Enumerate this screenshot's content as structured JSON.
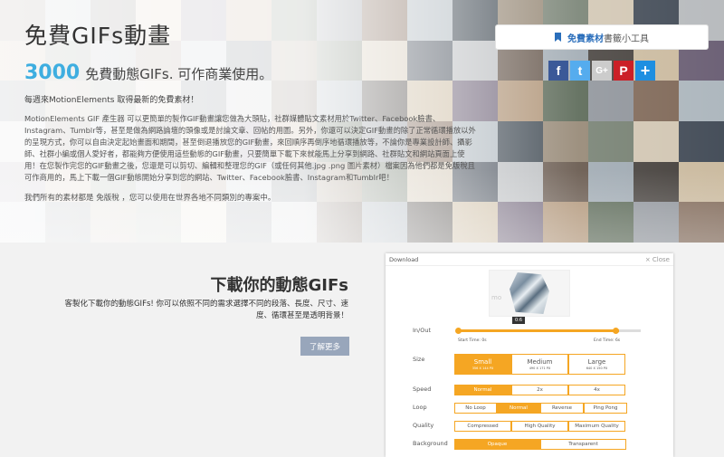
{
  "hero": {
    "title": "免費GIFs動畫",
    "count": "3000",
    "subtitle": "免費動態GIFs. 可作商業使用。",
    "weekly": "每週來MotionElements 取得最新的免費素材！",
    "description": "MotionElements GIF 產生器 可以更簡單的製作GIF動畫讓您做為大頭貼，社群媒體貼文素材用於Twitter、Facebook臉書、Instagram、Tumblr等，甚至是做為網路論壇的頭像或是討論文章、回帖的用圖。另外，你還可以決定GIF動畫的除了正常循環播放以外的呈現方式，你可以自由決定起始畫面和期間，甚至倒退播放您的GIF動畫，來回順序再倒序地循環播放等，不論你是專業設計師、攝影師、社群小編或個人愛好者，都能夠方便使用這些動態的GIF動畫，只要簡單下載下來就能馬上分享到網路、社群貼文和網站頁面上使用！在您製作完您的GIF動畫之後，您還是可以剪切、編輯和整理您的GIF（或任何其他.jpg .png 圖片素材）檔案因為他們都是免版稅且可作商用的，馬上下載一個GIF動態開始分享到您的網站、Twitter、Facebook臉書、Instagram和Tumblr吧！",
    "note": "我們所有的素材都是 免版稅 ，您可以使用在世界各地不同類別的專案中。"
  },
  "toolbox": {
    "highlight": "免費素材",
    "rest": "書籤小工具"
  },
  "share": {
    "facebook": "f",
    "twitter": "t",
    "gplus": "G+",
    "pinterest": "P",
    "more": "+"
  },
  "download_section": {
    "title": "下載你的動態GIFs",
    "description": "客製化下載你的動態GIFs! 你可以依照不同的需求選擇不同的段落、長度、尺寸、速度、循環甚至是透明背景！",
    "button": "了解更多"
  },
  "panel": {
    "header": "Download",
    "close": "× Close",
    "watermark": "mo",
    "time_tag": "0:6",
    "inout_label": "In/Out",
    "start_time": "Start Time: 0s",
    "end_time": "End Time: 6s",
    "in_fraction": 0,
    "out_fraction": 0.86,
    "size_label": "Size",
    "size_options": [
      {
        "label": "Small",
        "dims": "356 X 144 PX",
        "selected": true
      },
      {
        "label": "Medium",
        "dims": "490 X 171 PX",
        "selected": false
      },
      {
        "label": "Large",
        "dims": "640 X 150 PX",
        "selected": false
      }
    ],
    "speed_label": "Speed",
    "speed_options": [
      {
        "label": "Normal",
        "selected": true
      },
      {
        "label": "2x",
        "selected": false
      },
      {
        "label": "4x",
        "selected": false
      }
    ],
    "loop_label": "Loop",
    "loop_options": [
      {
        "label": "No Loop",
        "selected": false
      },
      {
        "label": "Normal",
        "selected": true
      },
      {
        "label": "Reverse",
        "selected": false
      },
      {
        "label": "Ping Pong",
        "selected": false
      }
    ],
    "quality_label": "Quality",
    "quality_options": [
      {
        "label": "Compressed",
        "selected": false
      },
      {
        "label": "High Quality",
        "selected": false
      },
      {
        "label": "Maximum Quality",
        "selected": false
      }
    ],
    "background_label": "Background",
    "background_options": [
      {
        "label": "Opaque",
        "selected": true
      },
      {
        "label": "Transparent",
        "selected": false
      }
    ]
  },
  "colors": {
    "accent": "#f5a623",
    "count_blue": "#3eaee0",
    "link_blue": "#2a6ebb",
    "button_gray": "#98a6bb"
  }
}
